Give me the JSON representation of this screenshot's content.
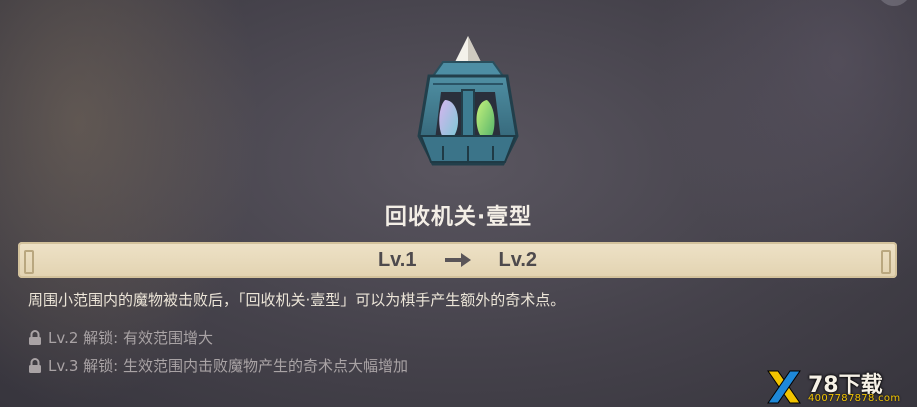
{
  "item": {
    "name": "回收机关·壹型",
    "icon": "recycling-gadget-icon"
  },
  "level_bar": {
    "from": "Lv.1",
    "to": "Lv.2",
    "arrow_icon": "right-arrow-icon"
  },
  "description": "周围小范围内的魔物被击败后，「回收机关·壹型」可以为棋手产生额外的奇术点。",
  "unlocks": [
    {
      "icon": "lock-icon",
      "text": "Lv.2 解锁: 有效范围增大"
    },
    {
      "icon": "lock-icon",
      "text": "Lv.3 解锁: 生效范围内击败魔物产生的奇术点大幅增加"
    }
  ],
  "watermark": {
    "logo": "x-logo",
    "name": "78下载",
    "url": "4007787878.com"
  },
  "colors": {
    "bar_background": "#e2d3b1",
    "title_text": "#f3eee6",
    "unlock_text": "#a9a3a5",
    "watermark_accent": "#f2c400"
  }
}
